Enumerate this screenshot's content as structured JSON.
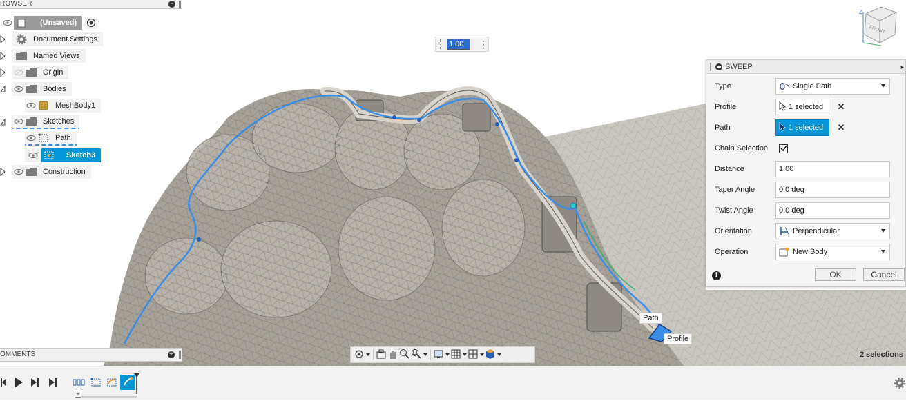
{
  "browser": {
    "title": "ROWSER",
    "items": [
      {
        "label": "(Unsaved)"
      },
      {
        "label": "Document Settings"
      },
      {
        "label": "Named Views"
      },
      {
        "label": "Origin"
      },
      {
        "label": "Bodies"
      },
      {
        "label": "MeshBody1"
      },
      {
        "label": "Sketches"
      },
      {
        "label": "Path"
      },
      {
        "label": "Sketch3"
      },
      {
        "label": "Construction"
      }
    ]
  },
  "comments": {
    "title": "OMMENTS"
  },
  "mini_input": {
    "value": "1.00"
  },
  "viewport": {
    "callouts": {
      "path": "Path",
      "profile": "Profile"
    },
    "selections": "2 selections"
  },
  "sweep": {
    "title": "SWEEP",
    "type": {
      "label": "Type",
      "value": "Single Path"
    },
    "profile": {
      "label": "Profile",
      "value": "1 selected"
    },
    "path": {
      "label": "Path",
      "value": "1 selected"
    },
    "chain": {
      "label": "Chain Selection",
      "checked": true
    },
    "distance": {
      "label": "Distance",
      "value": "1.00"
    },
    "taper": {
      "label": "Taper Angle",
      "value": "0.0 deg"
    },
    "twist": {
      "label": "Twist Angle",
      "value": "0.0 deg"
    },
    "orientation": {
      "label": "Orientation",
      "value": "Perpendicular"
    },
    "operation": {
      "label": "Operation",
      "value": "New Body"
    },
    "ok": "OK",
    "cancel": "Cancel"
  },
  "colors": {
    "accent": "#0696d7",
    "path_curve": "#3a8ee6",
    "mesh_fill": "#a7a299"
  }
}
